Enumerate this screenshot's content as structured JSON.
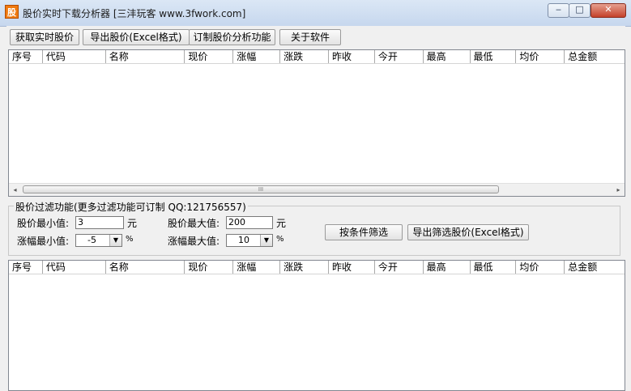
{
  "window": {
    "title": "股价实时下载分析器 [三沣玩客 www.3fwork.com]",
    "icon_glyph": "股",
    "minimize_glyph": "‒",
    "maximize_glyph": "□",
    "close_glyph": "✕"
  },
  "toolbar": {
    "get_realtime": "获取实时股价",
    "export_excel": "导出股价(Excel格式)",
    "subscribe": "订制股价分析功能",
    "about": "关于软件"
  },
  "columns": [
    "序号",
    "代码",
    "名称",
    "现价",
    "涨幅",
    "涨跌",
    "昨收",
    "今开",
    "最高",
    "最低",
    "均价",
    "总金额"
  ],
  "scrollbar": {
    "left_arrow": "◂",
    "right_arrow": "▸",
    "grip": "III"
  },
  "filter": {
    "group_title": "股价过滤功能(更多过滤功能可订制 QQ:121756557)",
    "min_price_label": "股价最小值:",
    "min_price_value": "3",
    "min_price_unit": "元",
    "max_price_label": "股价最大值:",
    "max_price_value": "200",
    "max_price_unit": "元",
    "min_change_label": "涨幅最小值:",
    "min_change_value": "-5",
    "min_change_unit": "%",
    "max_change_label": "涨幅最大值:",
    "max_change_value": "10",
    "max_change_unit": "%",
    "filter_button": "按条件筛选",
    "export_filtered_button": "导出筛选股价(Excel格式)",
    "dropdown_glyph": "▼"
  }
}
